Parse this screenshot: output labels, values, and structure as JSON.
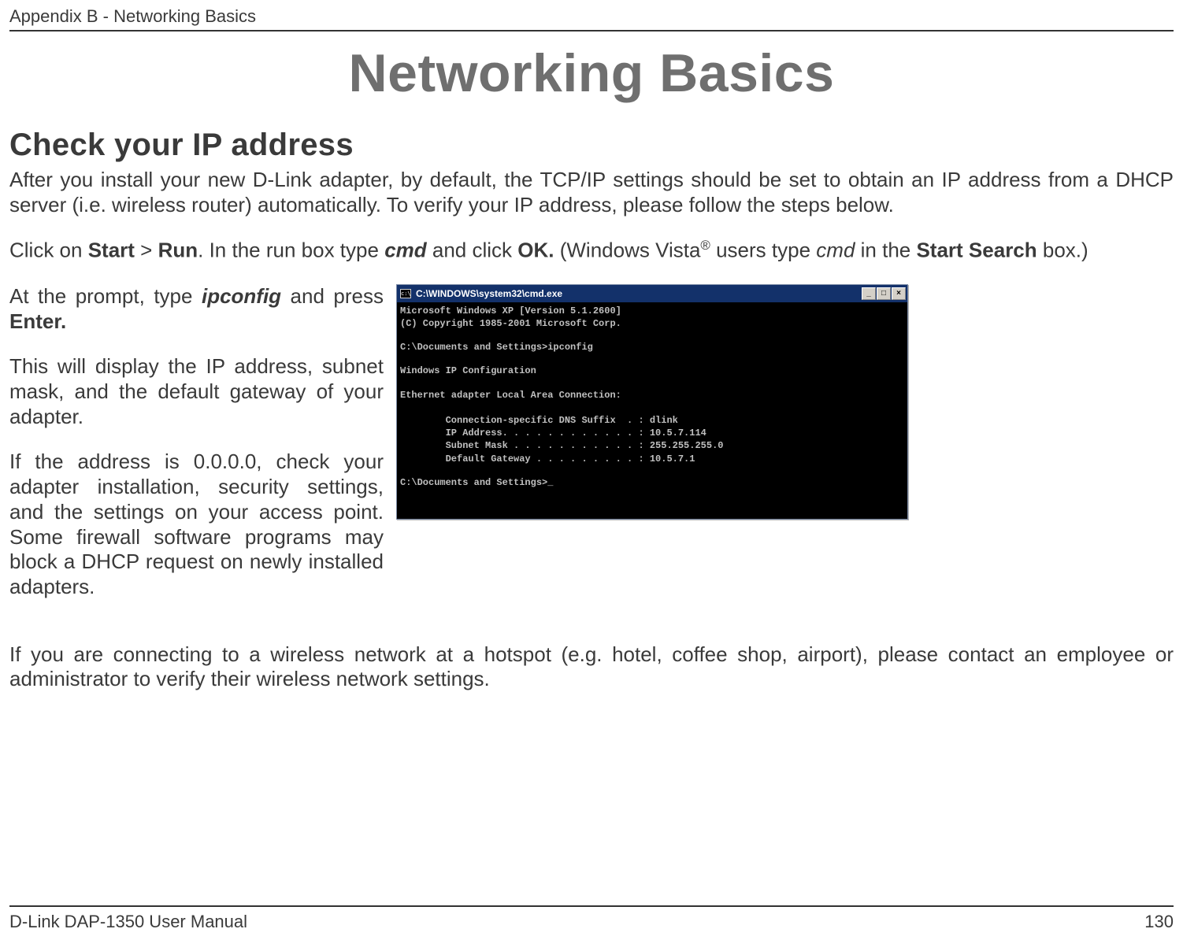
{
  "header": {
    "running_head": "Appendix B - Networking Basics"
  },
  "title": "Networking Basics",
  "section": {
    "heading": "Check your IP address",
    "para1": "After you install your new D-Link adapter, by default, the TCP/IP settings should be set to obtain an IP address from a DHCP server (i.e. wireless router) automatically. To verify your IP address, please follow the steps below.",
    "para2_pre": "Click on ",
    "para2_start_bold": "Start",
    "para2_gt": " > ",
    "para2_run_bold": "Run",
    "para2_mid1": ". In the run box type ",
    "para2_cmd_bi": "cmd",
    "para2_mid2": " and click ",
    "para2_ok_bold": "OK.",
    "para2_mid3": " (Windows Vista",
    "para2_reg": "®",
    "para2_mid4": " users type ",
    "para2_cmd_i": "cmd",
    "para2_mid5": " in the ",
    "para2_startsearch_bold": "Start Search",
    "para2_end": " box.)",
    "para3_pre": "At the prompt, type ",
    "para3_ipconfig_bi": "ipconfig",
    "para3_mid": " and press ",
    "para3_enter_bold": "Enter.",
    "para4": "This will display the IP address, subnet mask, and the default gateway of your adapter.",
    "para5": "If the address is 0.0.0.0, check your adapter installation, security settings, and the settings on your access point. Some firewall software programs may block a DHCP request on newly installed adapters.",
    "para6": "If you are connecting to a wireless network at a hotspot (e.g. hotel, coffee shop, airport), please contact an employee or administrator to verify their wireless network settings."
  },
  "cmd": {
    "title": "C:\\WINDOWS\\system32\\cmd.exe",
    "line1": "Microsoft Windows XP [Version 5.1.2600]",
    "line2": "(C) Copyright 1985-2001 Microsoft Corp.",
    "line3": "C:\\Documents and Settings>ipconfig",
    "line4": "Windows IP Configuration",
    "line5": "Ethernet adapter Local Area Connection:",
    "line6": "        Connection-specific DNS Suffix  . : dlink",
    "line7": "        IP Address. . . . . . . . . . . . : 10.5.7.114",
    "line8": "        Subnet Mask . . . . . . . . . . . : 255.255.255.0",
    "line9": "        Default Gateway . . . . . . . . . : 10.5.7.1",
    "line10": "C:\\Documents and Settings>_",
    "min_btn": "_",
    "max_btn": "□",
    "close_btn": "×"
  },
  "footer": {
    "manual": "D-Link DAP-1350 User Manual",
    "page": "130"
  }
}
